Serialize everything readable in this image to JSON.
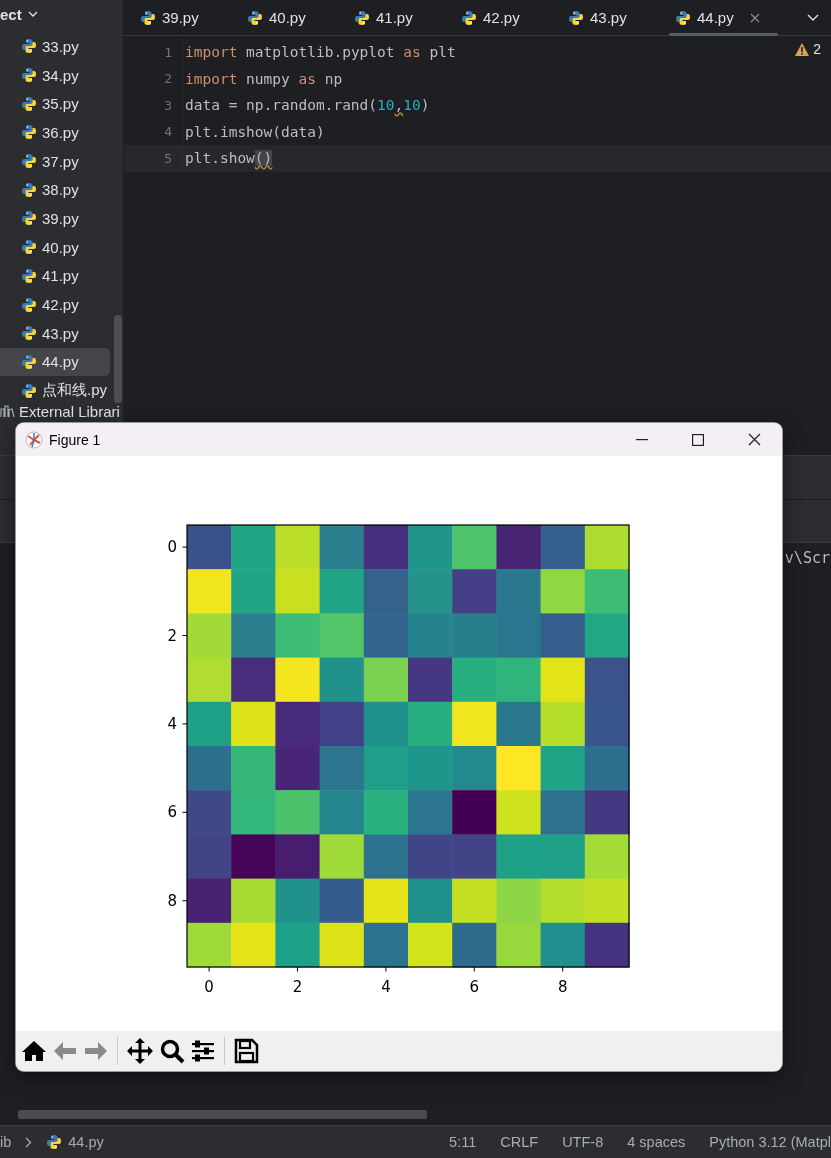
{
  "sidebar": {
    "header": "ect",
    "items": [
      {
        "label": "33.py",
        "selected": false
      },
      {
        "label": "34.py",
        "selected": false
      },
      {
        "label": "35.py",
        "selected": false
      },
      {
        "label": "36.py",
        "selected": false
      },
      {
        "label": "37.py",
        "selected": false
      },
      {
        "label": "38.py",
        "selected": false
      },
      {
        "label": "39.py",
        "selected": false
      },
      {
        "label": "40.py",
        "selected": false
      },
      {
        "label": "41.py",
        "selected": false
      },
      {
        "label": "42.py",
        "selected": false
      },
      {
        "label": "43.py",
        "selected": false
      },
      {
        "label": "44.py",
        "selected": true
      },
      {
        "label": "点和线.py",
        "selected": false
      }
    ],
    "footer": "External Librari"
  },
  "tabs": [
    {
      "label": "39.py",
      "selected": false
    },
    {
      "label": "40.py",
      "selected": false
    },
    {
      "label": "41.py",
      "selected": false
    },
    {
      "label": "42.py",
      "selected": false
    },
    {
      "label": "43.py",
      "selected": false
    },
    {
      "label": "44.py",
      "selected": true
    }
  ],
  "editor": {
    "warning_count": "2",
    "lines": [
      {
        "number": "1",
        "current": false,
        "tokens": [
          {
            "kind": "keyword",
            "text": "import"
          },
          {
            "kind": "plain",
            "text": " matplotlib.pyplot "
          },
          {
            "kind": "keyword",
            "text": "as"
          },
          {
            "kind": "plain",
            "text": " plt"
          }
        ]
      },
      {
        "number": "2",
        "current": false,
        "tokens": [
          {
            "kind": "keyword",
            "text": "import"
          },
          {
            "kind": "plain",
            "text": " numpy "
          },
          {
            "kind": "keyword",
            "text": "as"
          },
          {
            "kind": "plain",
            "text": " np"
          }
        ]
      },
      {
        "number": "3",
        "current": false,
        "tokens": [
          {
            "kind": "plain",
            "text": "data = np.random.rand("
          },
          {
            "kind": "number",
            "text": "10"
          },
          {
            "kind": "warning",
            "text": ","
          },
          {
            "kind": "number",
            "text": "10"
          },
          {
            "kind": "plain",
            "text": ")"
          }
        ]
      },
      {
        "number": "4",
        "current": false,
        "tokens": [
          {
            "kind": "plain",
            "text": "plt.imshow(data)"
          }
        ]
      },
      {
        "number": "5",
        "current": true,
        "tokens": [
          {
            "kind": "plain",
            "text": "plt.show"
          },
          {
            "kind": "matched",
            "text": "()"
          }
        ]
      }
    ]
  },
  "console": {
    "text": "v\\Scr"
  },
  "figure": {
    "title": "Figure 1",
    "yticks": [
      "0",
      "2",
      "4",
      "6",
      "8"
    ],
    "xticks": [
      "0",
      "2",
      "4",
      "6",
      "8"
    ],
    "toolbar": [
      {
        "kind": "home",
        "disabled": false
      },
      {
        "kind": "back",
        "disabled": true
      },
      {
        "kind": "forward",
        "disabled": true
      },
      {
        "kind": "separator"
      },
      {
        "kind": "pan",
        "disabled": false
      },
      {
        "kind": "zoom",
        "disabled": false
      },
      {
        "kind": "configure",
        "disabled": false
      },
      {
        "kind": "separator"
      },
      {
        "kind": "save",
        "disabled": false
      }
    ]
  },
  "status_bar": {
    "breadcrumbs": [
      "ib",
      "44.py"
    ],
    "items": [
      "5:11",
      "CRLF",
      "UTF-8",
      "4 spaces",
      "Python 3.12 (Matpl"
    ]
  }
}
